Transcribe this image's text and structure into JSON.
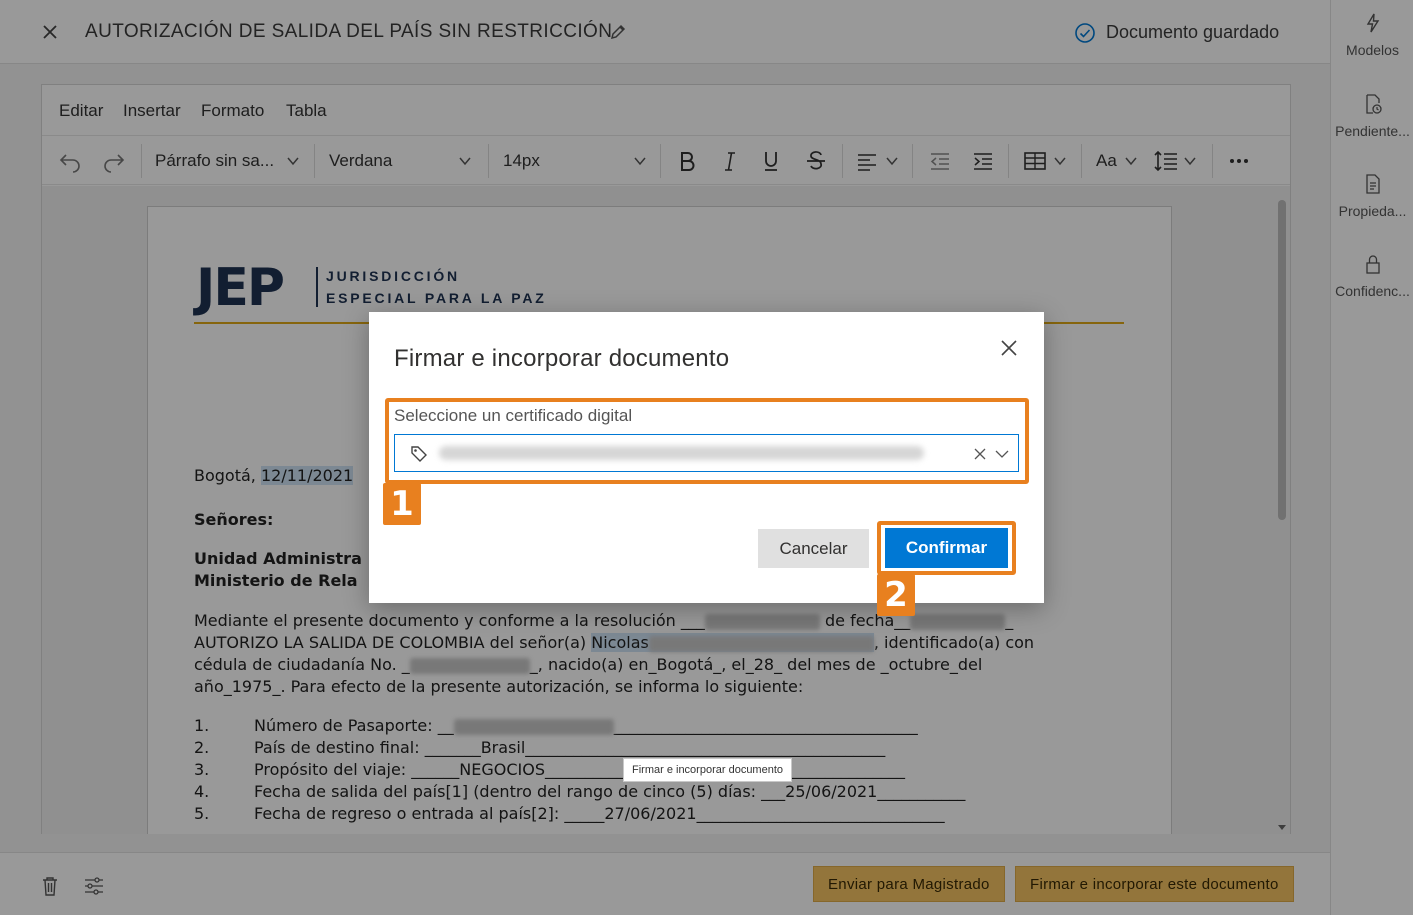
{
  "header": {
    "title": "AUTORIZACIÓN DE SALIDA DEL PAÍS SIN RESTRICCIÓN",
    "saved_status": "Documento guardado"
  },
  "right_panel": {
    "items": [
      {
        "label": "Modelos",
        "icon": "lightning-icon"
      },
      {
        "label": "Pendiente...",
        "icon": "document-clock-icon"
      },
      {
        "label": "Propieda...",
        "icon": "document-properties-icon"
      },
      {
        "label": "Confidenc...",
        "icon": "lock-icon"
      }
    ]
  },
  "editor": {
    "menu": [
      "Editar",
      "Insertar",
      "Formato",
      "Tabla"
    ],
    "toolbar": {
      "block_format": "Párrafo sin sa...",
      "font_family": "Verdana",
      "font_size": "14px",
      "case_label": "Aa"
    }
  },
  "document": {
    "logo_mark": "JEP",
    "logo_line1": "JURISDICCIÓN",
    "logo_line2": "ESPECIAL PARA LA PAZ",
    "city": "Bogotá, ",
    "date": "12/11/2021",
    "salutation": "Señores:",
    "recipient1": "Unidad Administra",
    "recipient2": "Ministerio de Rela",
    "p1_a": "Mediante el presente documento y conforme a la resolución ___",
    "p1_b": " de fecha__",
    "p1_c": "_",
    "p2_a": "AUTORIZO LA SALIDA DE COLOMBIA del señor(a) ",
    "p2_name": "Nicolas",
    "p2_b": ", identificado(a) con",
    "p3_a": "cédula de ciudadanía No. _",
    "p3_b": "_, nacido(a) en_Bogotá_, el_28_ del mes de _octubre_del",
    "p4": "año_1975_. Para efecto de la presente autorización, se informa lo siguiente:",
    "list": [
      {
        "num": "1.",
        "a": "Número de Pasaporte:  __",
        "b": "______________________________________"
      },
      {
        "num": "2.",
        "a": "País de destino final: _______Brasil",
        "b": "_____________________________________________"
      },
      {
        "num": "3.",
        "a": "Propósito del viaje: ______NEGOCIOS___",
        "b": "__________________________________________"
      },
      {
        "num": "4.",
        "a": "Fecha de salida del país[1] (dentro del rango de cinco (5) días: ___25/06/2021___________",
        "b": ""
      },
      {
        "num": "5.",
        "a": "Fecha de regreso o entrada al país[2]:  _____27/06/2021_______________________________",
        "b": ""
      }
    ]
  },
  "footer": {
    "send_button": "Enviar para Magistrado",
    "sign_button": "Firmar e incorporar este documento"
  },
  "tooltip": "Firmar e incorporar documento",
  "dialog": {
    "title": "Firmar e incorporar documento",
    "field_label": "Seleccione un certificado digital",
    "certificate_value": "certificado-digital-oculto",
    "cancel_label": "Cancelar",
    "confirm_label": "Confirmar"
  },
  "callouts": {
    "step1": "1",
    "step2": "2",
    "color": "#e8801f"
  },
  "colors": {
    "accent": "#0078d4",
    "footer_button": "#f5c463",
    "highlight": "#cfe3f6"
  }
}
